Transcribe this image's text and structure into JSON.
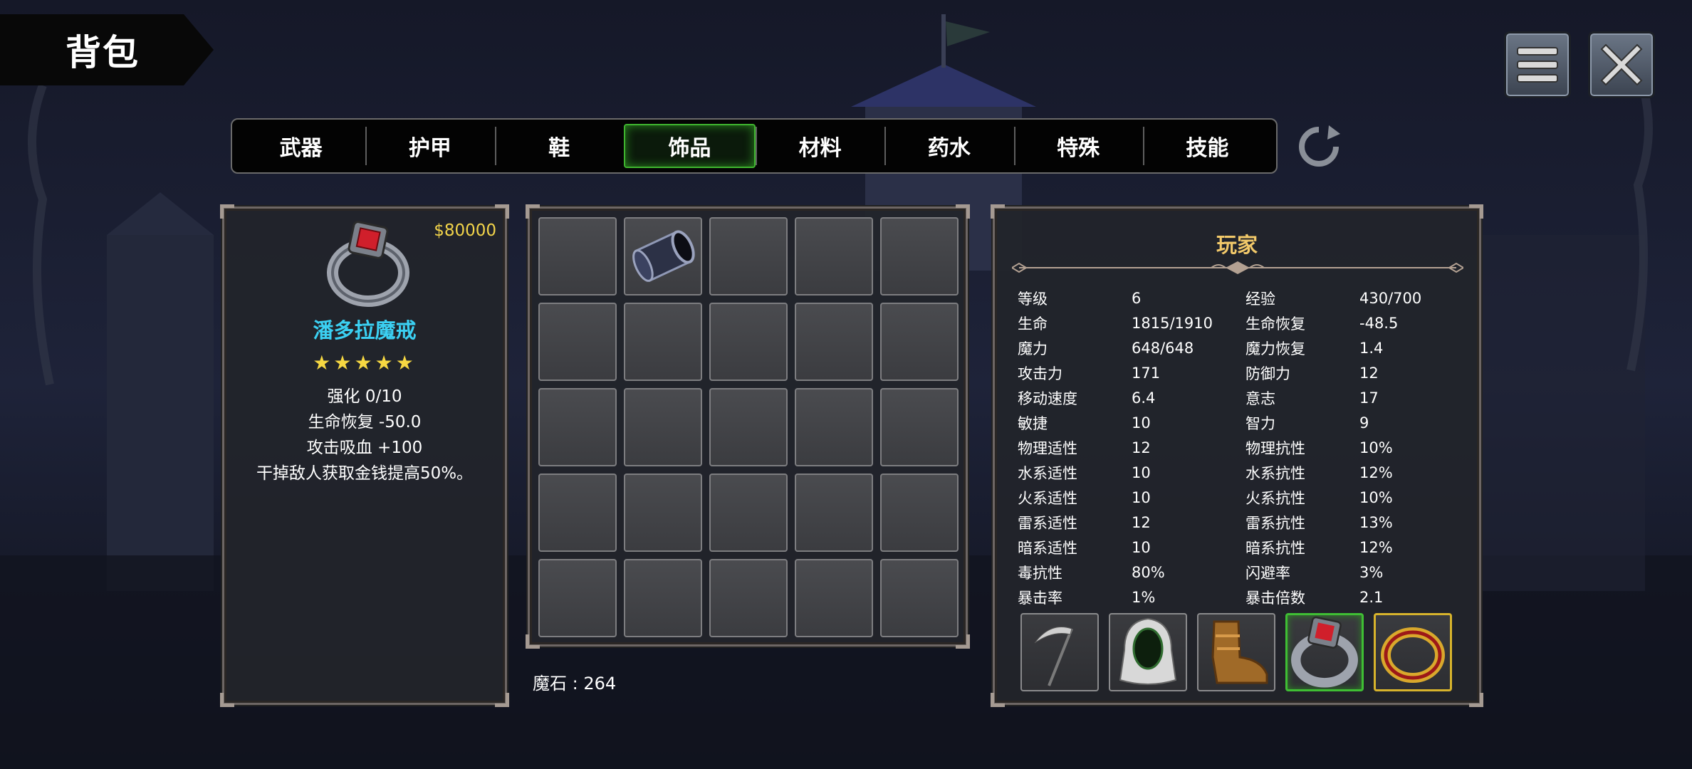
{
  "title": "背包",
  "header_buttons": {
    "menu_icon": "menu-icon",
    "close_icon": "close-icon"
  },
  "tabs": [
    {
      "label": "武器",
      "active": false
    },
    {
      "label": "护甲",
      "active": false
    },
    {
      "label": "鞋",
      "active": false
    },
    {
      "label": "饰品",
      "active": true
    },
    {
      "label": "材料",
      "active": false
    },
    {
      "label": "药水",
      "active": false
    },
    {
      "label": "特殊",
      "active": false
    },
    {
      "label": "技能",
      "active": false
    }
  ],
  "refresh_icon": "refresh-icon",
  "item_detail": {
    "price": "$80000",
    "icon": "ring-red-gem-icon",
    "name": "潘多拉魔戒",
    "stars": "★★★★★",
    "star_count": 5,
    "lines": [
      "强化 0/10",
      "生命恢复  -50.0",
      "攻击吸血  +100",
      "干掉敌人获取金钱提高50%。"
    ]
  },
  "inventory": {
    "rows": 5,
    "cols": 5,
    "items": [
      {
        "slot": 1,
        "icon": "dark-cylinder-icon"
      }
    ]
  },
  "magic_stone": "魔石 : 264",
  "player": {
    "title": "玩家",
    "stats": [
      [
        "等级",
        "6",
        "经验",
        "430/700"
      ],
      [
        "生命",
        "1815/1910",
        "生命恢复",
        "-48.5"
      ],
      [
        "魔力",
        "648/648",
        "魔力恢复",
        "1.4"
      ],
      [
        "攻击力",
        "171",
        "防御力",
        "12"
      ],
      [
        "移动速度",
        "6.4",
        "意志",
        "17"
      ],
      [
        "敏捷",
        "10",
        "智力",
        "9"
      ],
      [
        "物理适性",
        "12",
        "物理抗性",
        "10%"
      ],
      [
        "水系适性",
        "10",
        "水系抗性",
        "12%"
      ],
      [
        "火系适性",
        "10",
        "火系抗性",
        "10%"
      ],
      [
        "雷系适性",
        "12",
        "雷系抗性",
        "13%"
      ],
      [
        "暗系适性",
        "10",
        "暗系抗性",
        "12%"
      ],
      [
        "毒抗性",
        "80%",
        "闪避率",
        "3%"
      ],
      [
        "暴击率",
        "1%",
        "暴击倍数",
        "2.1"
      ]
    ],
    "equipment": [
      {
        "icon": "scythe-icon",
        "selected": false
      },
      {
        "icon": "hood-armor-icon",
        "selected": false
      },
      {
        "icon": "boots-icon",
        "selected": false
      },
      {
        "icon": "ring-red-gem-icon",
        "selected": true
      },
      {
        "icon": "gold-ring-icon",
        "selected": false,
        "highlight": "gold"
      }
    ]
  },
  "colors": {
    "price": "#f2d44a",
    "item_name": "#3bd0f2",
    "stars": "#f7d842",
    "player_title": "#f2c96a",
    "active_tab": "#3fb52f"
  }
}
